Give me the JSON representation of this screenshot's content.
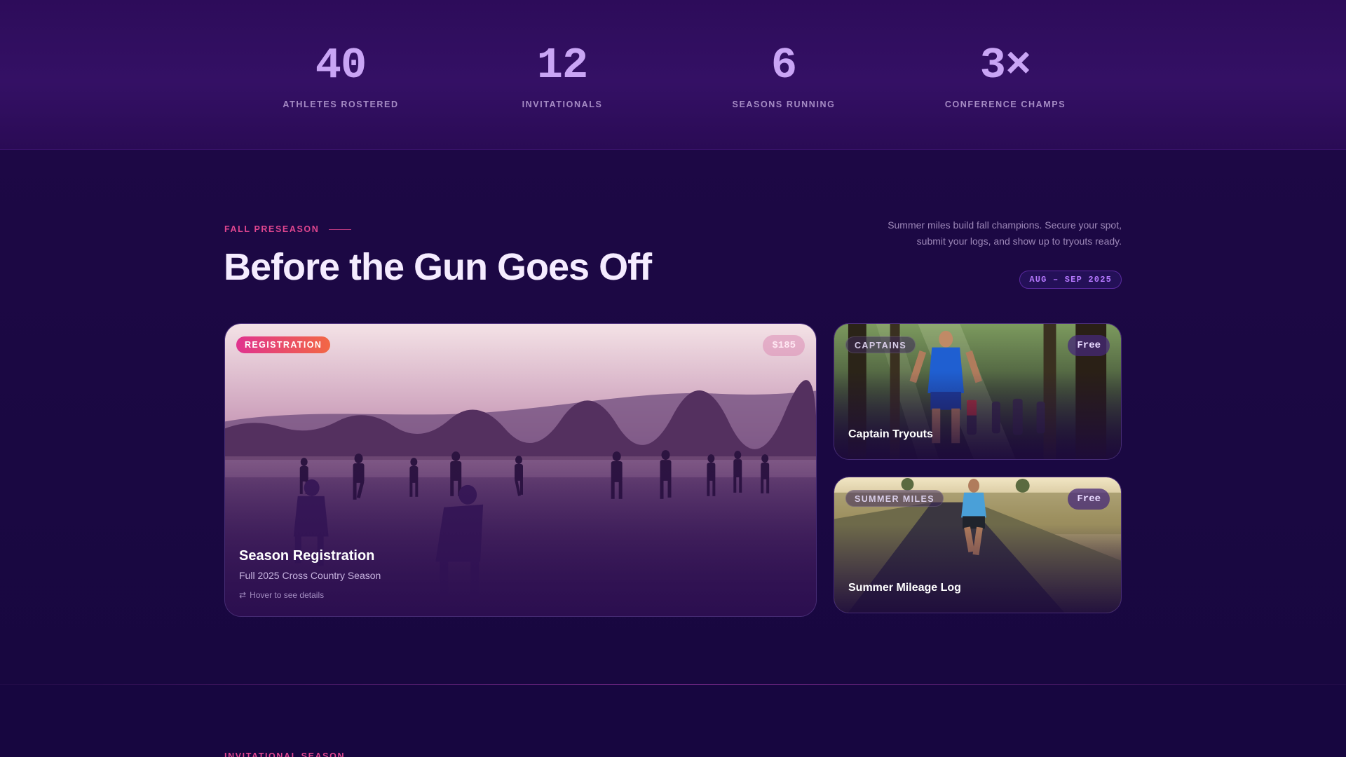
{
  "stats": [
    {
      "value": "40",
      "label": "ATHLETES ROSTERED"
    },
    {
      "value": "12",
      "label": "INVITATIONALS"
    },
    {
      "value": "6",
      "label": "SEASONS RUNNING"
    },
    {
      "value": "3×",
      "label": "CONFERENCE CHAMPS"
    }
  ],
  "preseason": {
    "eyebrow": "FALL PRESEASON",
    "title": "Before the Gun Goes Off",
    "intro": "Summer miles build fall champions. Secure your spot, submit your logs, and show up to tryouts ready.",
    "date_range": "AUG – SEP 2025"
  },
  "cards": {
    "registration": {
      "badge": "REGISTRATION",
      "price": "$185",
      "title": "Season Registration",
      "subtitle": "Full 2025 Cross Country Season",
      "hint": "Hover to see details",
      "hint_icon": "swap-arrows-icon"
    },
    "captains": {
      "badge": "CAPTAINS",
      "price": "Free",
      "title": "Captain Tryouts"
    },
    "summer": {
      "badge": "SUMMER MILES",
      "price": "Free",
      "title": "Summer Mileage Log"
    }
  },
  "next_section": {
    "eyebrow": "INVITATIONAL SEASON"
  },
  "colors": {
    "accent_pink": "#e0468f",
    "stat_violet": "#c9a5f5",
    "background": "#1a0840"
  }
}
